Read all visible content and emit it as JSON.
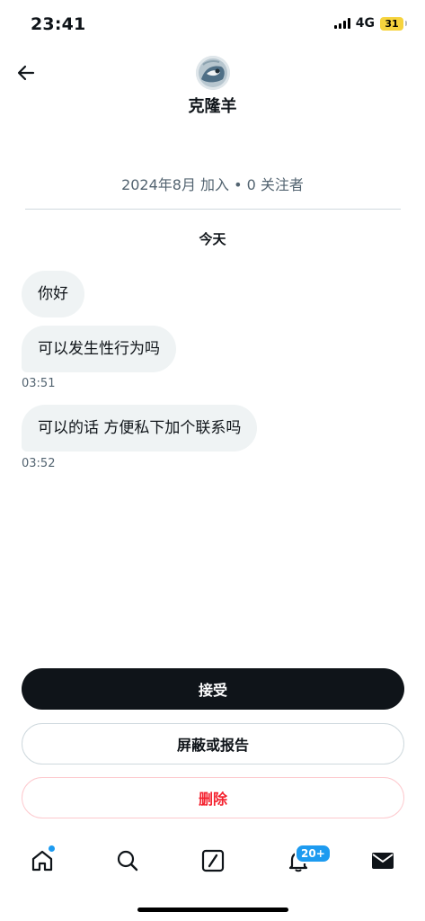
{
  "status_bar": {
    "time": "23:41",
    "network": "4G",
    "battery": "31"
  },
  "header": {
    "user_name": "克隆羊",
    "join_info": "2024年8月 加入 • 0 关注者"
  },
  "conversation": {
    "day_label": "今天",
    "messages": [
      {
        "text": "你好"
      },
      {
        "text": "可以发生性行为吗",
        "time": "03:51"
      },
      {
        "text": "可以的话 方便私下加个联系吗",
        "time": "03:52"
      }
    ]
  },
  "actions": {
    "accept": "接受",
    "block_or_report": "屏蔽或报告",
    "delete": "删除"
  },
  "bottom_nav": {
    "notification_badge": "20+",
    "active": "home",
    "colors": {
      "accent": "#1d9bf0",
      "danger": "#f4212e"
    }
  }
}
